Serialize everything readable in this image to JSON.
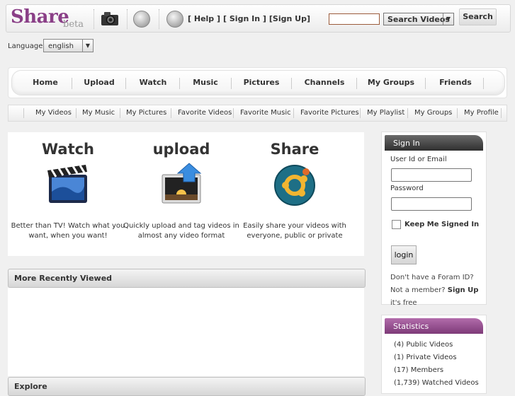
{
  "header": {
    "logo_text": "Share",
    "logo_tag": "beta",
    "links": [
      "[ Help ]",
      "[ Sign In ]",
      "[Sign Up]"
    ],
    "search": {
      "placeholder": "",
      "type_selected": "Search Videos",
      "button_label": "Search"
    }
  },
  "language": {
    "label": "Language:",
    "selected": "english"
  },
  "main_nav": [
    "Home",
    "Upload",
    "Watch",
    "Music",
    "Pictures",
    "Channels",
    "My Groups",
    "Friends"
  ],
  "sub_nav": [
    "My Videos",
    "My Music",
    "My Pictures",
    "Favorite Videos",
    "Favorite Music",
    "Favorite Pictures",
    "My Playlist",
    "My Groups",
    "My Profile"
  ],
  "features": [
    {
      "title": "Watch",
      "desc": "Better than TV! Watch what you want, when you want!",
      "icon": "clapperboard-icon"
    },
    {
      "title": "upload",
      "desc": "Quickly upload and tag videos in almost any video format",
      "icon": "upload-icon"
    },
    {
      "title": "Share",
      "desc": "Easily share your videos with everyone, public or private",
      "icon": "share-icon"
    }
  ],
  "sections": {
    "recent": "More Recently Viewed",
    "explore": "Explore"
  },
  "signin": {
    "title": "Sign In",
    "user_label": "User Id or Email",
    "password_label": "Password",
    "keep_label": "Keep Me Signed In",
    "login_label": "login",
    "note_prefix": "Don't have a Foram ID? Not a member?",
    "note_link": "Sign Up",
    "note_suffix": "it's free"
  },
  "stats": {
    "title": "Statistics",
    "items": [
      "(4) Public Videos",
      "(1) Private Videos",
      "(17) Members",
      "(1,739) Watched Videos"
    ]
  },
  "colors": {
    "brand": "#8a3f87",
    "stats_header": "#9c509a",
    "signin_header": "#3a3a3a"
  }
}
